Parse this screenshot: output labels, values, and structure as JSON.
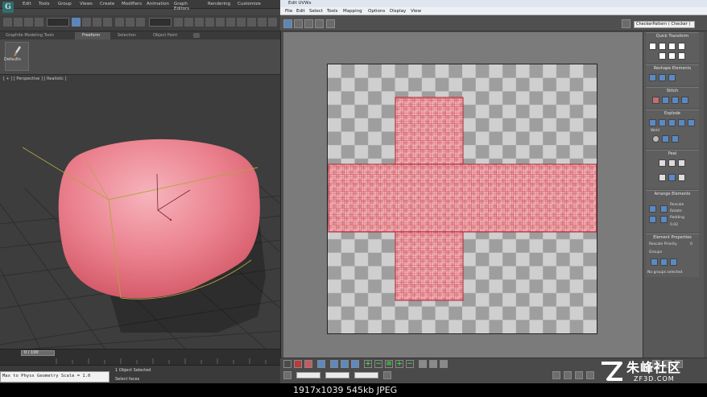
{
  "max_app": {
    "logo_letter": "G",
    "menu": [
      "Edit",
      "Tools",
      "Group",
      "Views",
      "Create",
      "Modifiers",
      "Animation",
      "Graph Editors",
      "Rendering",
      "Customize"
    ],
    "ribbon_tabs": [
      "Graphite Modeling Tools",
      "Freeform",
      "Selection",
      "Object Paint"
    ],
    "ribbon_active": "Freeform",
    "defaults_label": "Defaults",
    "viewport_label": "[ + ] [ Perspective ] [ Realistic ]",
    "time_label": "0 / 100",
    "maxscript_text": "Max to Physx Geometry Scale = 1.0",
    "status_objects": "1 Object Selected",
    "status_prompt": "Select faces"
  },
  "uv_window": {
    "title": "Edit UVWs",
    "menu": [
      "File",
      "Edit",
      "Select",
      "Tools",
      "Mapping",
      "Options",
      "Display",
      "View"
    ],
    "checker_dropdown": "CheckerPattern ( Checker )",
    "panel": {
      "quick_transform": "Quick Transform",
      "reshape": "Reshape Elements",
      "stitch": "Stitch",
      "explode": "Explode",
      "weld": "Weld",
      "peel": "Peel",
      "arrange": "Arrange Elements",
      "rescale": "Rescale",
      "rotate": "Rotate",
      "padding": "Padding",
      "padding_value": "0.02",
      "element_props": "Element Properties",
      "rescale_priority": "Rescale Priority",
      "rescale_priority_value": "0",
      "groups": "Groups",
      "no_groups": "No groups selected"
    }
  },
  "footer": {
    "image_info": "1917x1039  545kb  JPEG"
  },
  "watermark": {
    "main": "朱峰社区",
    "sub": "ZF3D.COM"
  },
  "colors": {
    "cushion": "#e26a77",
    "uv_red": "#d9313b",
    "checker_light": "#cfcfcf",
    "checker_dark": "#9e9e9e",
    "accent_blue": "#5c86b8"
  }
}
